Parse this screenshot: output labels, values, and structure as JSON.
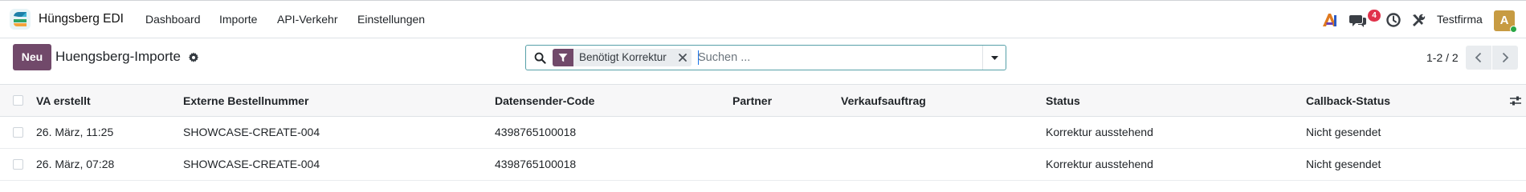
{
  "navbar": {
    "app_name": "Hüngsberg EDI",
    "menu": [
      {
        "label": "Dashboard"
      },
      {
        "label": "Importe"
      },
      {
        "label": "API-Verkehr"
      },
      {
        "label": "Einstellungen"
      }
    ],
    "ai_icon": "ai-icon",
    "messages_count": "4",
    "company": "Testfirma",
    "avatar_letter": "A"
  },
  "control_panel": {
    "new_button": "Neu",
    "title": "Huengsberg-Importe",
    "search": {
      "facet_label": "Benötigt Korrektur",
      "placeholder": "Suchen ..."
    },
    "pager": "1-2 / 2"
  },
  "table": {
    "columns": [
      "VA erstellt",
      "Externe Bestellnummer",
      "Datensender-Code",
      "Partner",
      "Verkaufsauftrag",
      "Status",
      "Callback-Status"
    ],
    "rows": [
      [
        "26. März, 11:25",
        "SHOWCASE-CREATE-004",
        "4398765100018",
        "",
        "",
        "Korrektur ausstehend",
        "Nicht gesendet"
      ],
      [
        "26. März, 07:28",
        "SHOWCASE-CREATE-004",
        "4398765100018",
        "",
        "",
        "Korrektur ausstehend",
        "Nicht gesendet"
      ]
    ]
  },
  "colors": {
    "brand": "#71496a",
    "focus": "#56a0a8",
    "badge": "#e0324b",
    "avatar": "#c79b42"
  }
}
